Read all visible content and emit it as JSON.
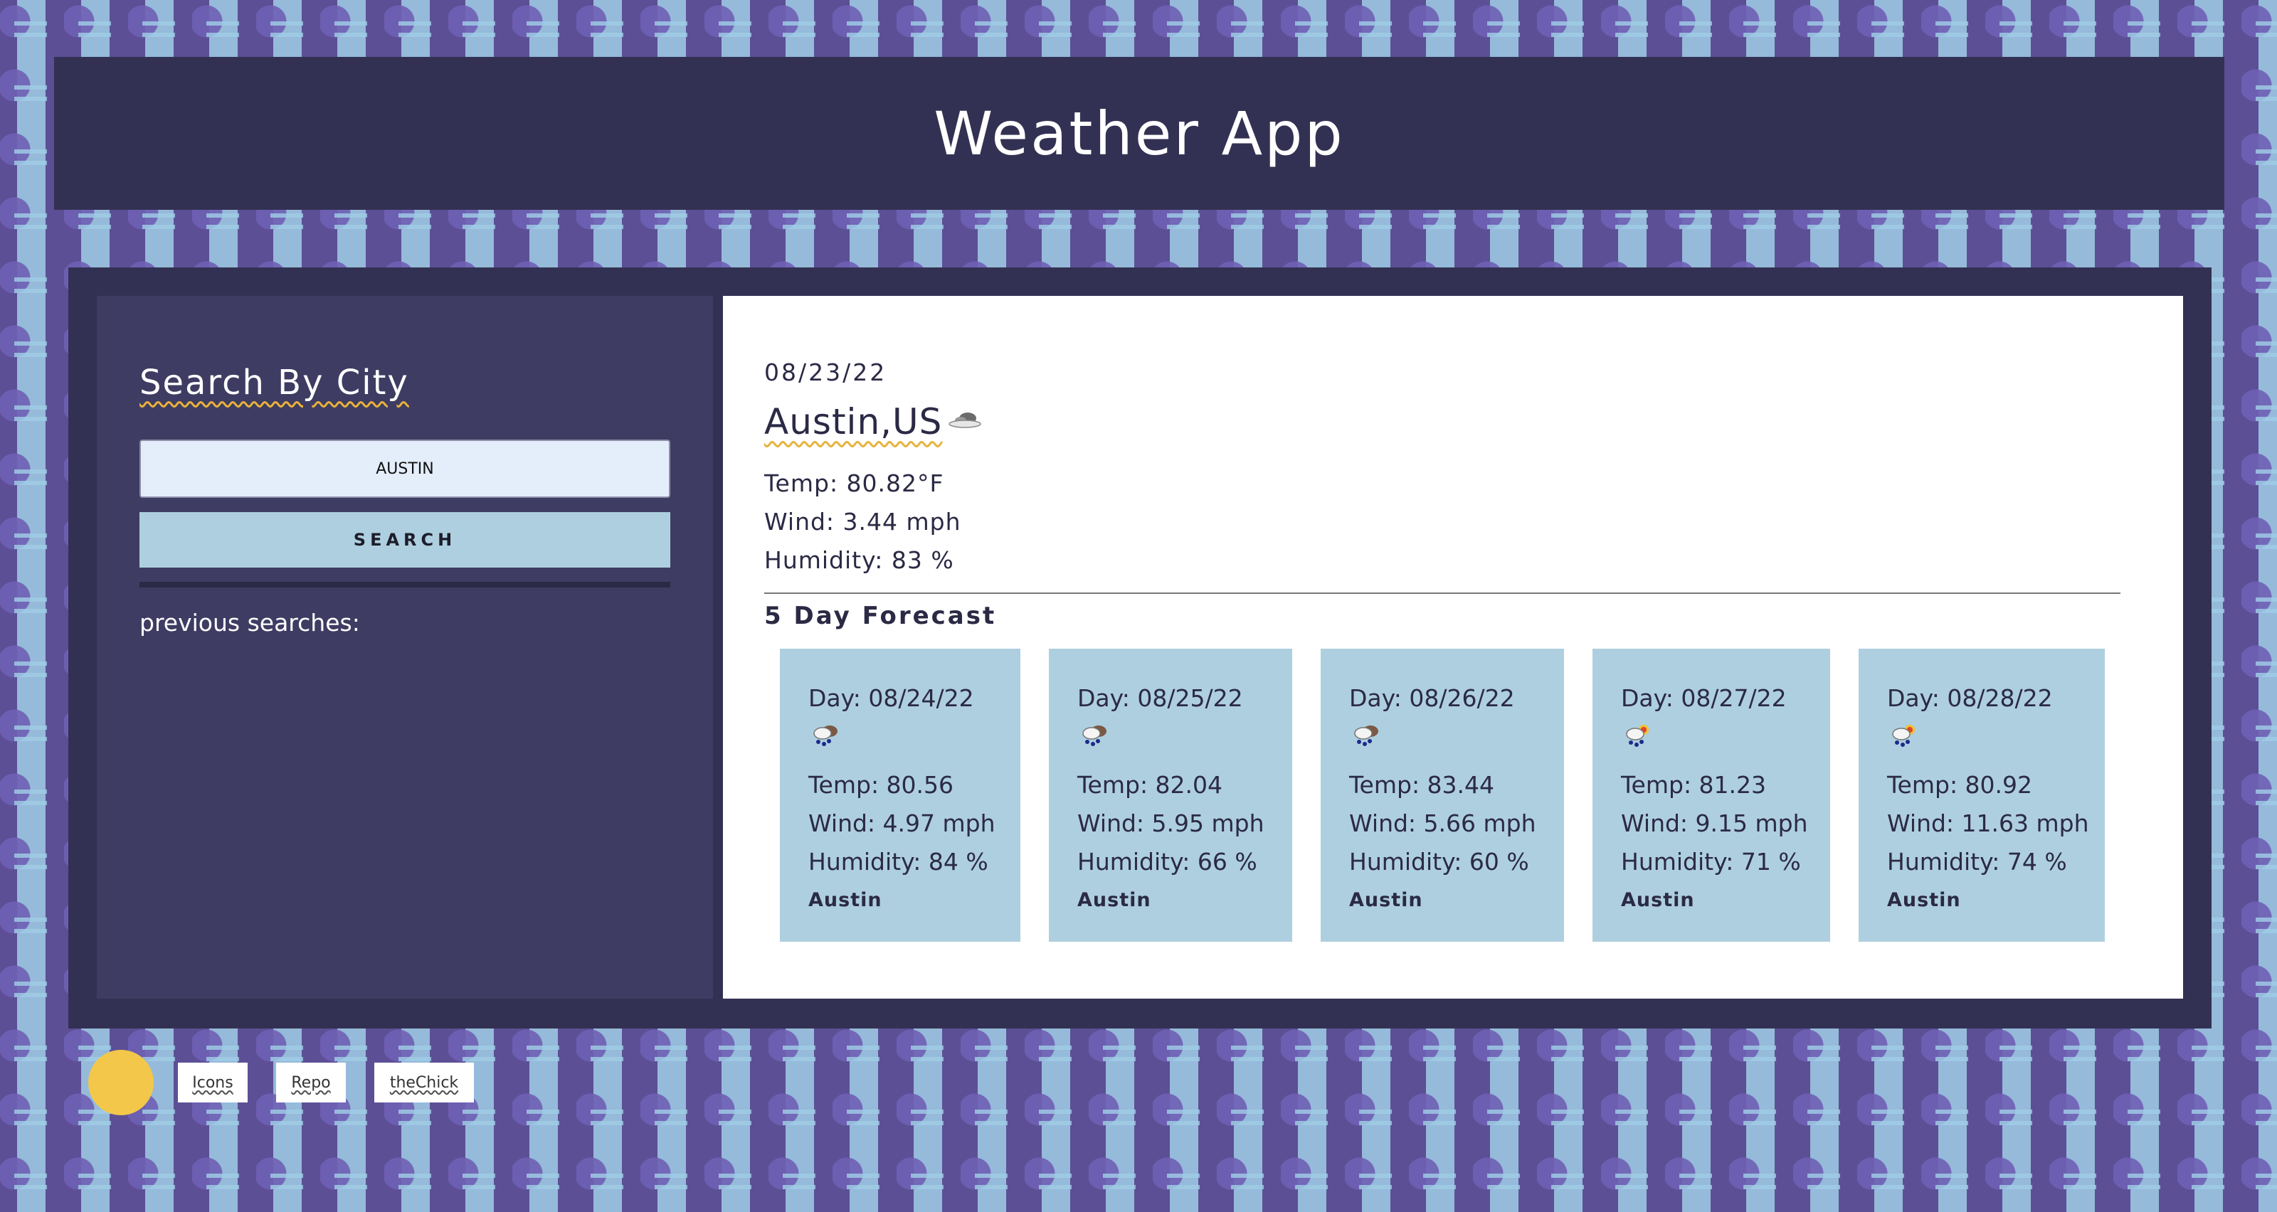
{
  "app": {
    "title": "Weather App"
  },
  "search": {
    "heading": "Search By City",
    "input_value": "AUSTIN",
    "button_label": "SEARCH",
    "previous_label": "previous searches:"
  },
  "current": {
    "date": "08/23/22",
    "city": "Austin,US",
    "icon": "cloudy-icon",
    "temp": "Temp: 80.82°F",
    "wind": "Wind: 3.44 mph",
    "humidity": "Humidity: 83 %"
  },
  "forecast": {
    "title": "5 Day Forecast",
    "days": [
      {
        "date": "Day: 08/24/22",
        "icon": "rain-cloud-icon",
        "temp": "Temp: 80.56",
        "wind": "Wind: 4.97 mph",
        "humidity": "Humidity: 84 %",
        "city": "Austin"
      },
      {
        "date": "Day: 08/25/22",
        "icon": "rain-cloud-icon",
        "temp": "Temp: 82.04",
        "wind": "Wind: 5.95 mph",
        "humidity": "Humidity: 66 %",
        "city": "Austin"
      },
      {
        "date": "Day: 08/26/22",
        "icon": "rain-cloud-icon",
        "temp": "Temp: 83.44",
        "wind": "Wind: 5.66 mph",
        "humidity": "Humidity: 60 %",
        "city": "Austin"
      },
      {
        "date": "Day: 08/27/22",
        "icon": "sun-rain-cloud-icon",
        "temp": "Temp: 81.23",
        "wind": "Wind: 9.15 mph",
        "humidity": "Humidity: 71 %",
        "city": "Austin"
      },
      {
        "date": "Day: 08/28/22",
        "icon": "sun-rain-cloud-icon",
        "temp": "Temp: 80.92",
        "wind": "Wind: 11.63 mph",
        "humidity": "Humidity: 74 %",
        "city": "Austin"
      }
    ]
  },
  "footer": {
    "links": [
      "Icons",
      "Repo",
      "theChick"
    ]
  },
  "colors": {
    "background": "#5c4f95",
    "panel_dark": "#333153",
    "sidebar": "#3f3c63",
    "card": "#aecfdf",
    "accent_yellow": "#f3c84a",
    "input_bg": "#e4eefb"
  }
}
